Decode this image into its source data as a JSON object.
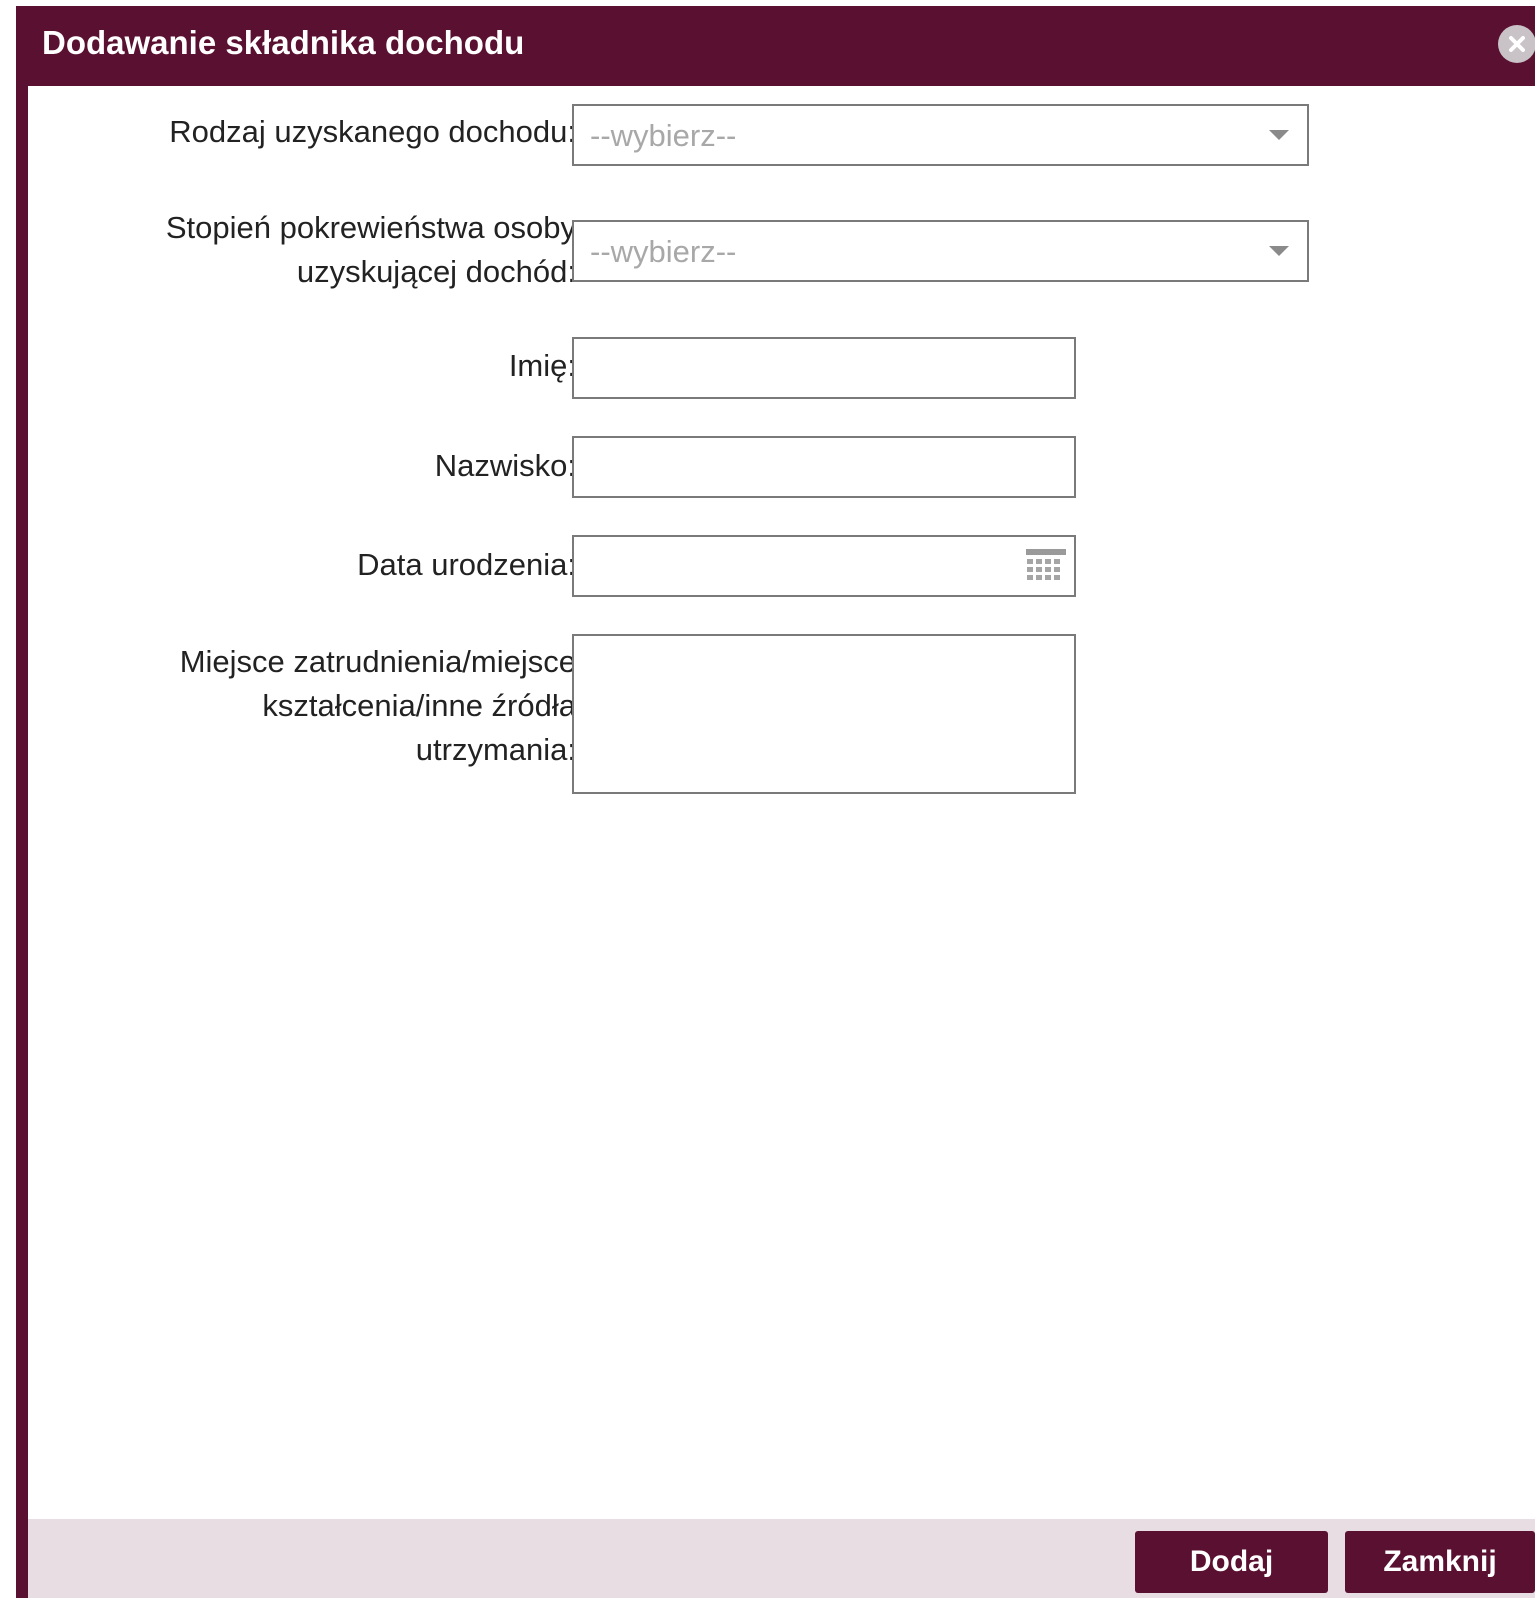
{
  "dialog": {
    "title": "Dodawanie składnika dochodu",
    "close_icon": "close-icon"
  },
  "form": {
    "income_type": {
      "label": "Rodzaj uzyskanego dochodu:",
      "placeholder": "--wybierz--"
    },
    "kinship": {
      "label_line1": "Stopień pokrewieństwa osoby",
      "label_line2": "uzyskującej dochód:",
      "placeholder": "--wybierz--"
    },
    "first_name": {
      "label": "Imię:",
      "value": ""
    },
    "last_name": {
      "label": "Nazwisko:",
      "value": ""
    },
    "birth_date": {
      "label": "Data urodzenia:",
      "value": "",
      "icon": "calendar-icon"
    },
    "workplace": {
      "label_line1": "Miejsce zatrudnienia/miejsce",
      "label_line2": "kształcenia/inne źródła",
      "label_line3": "utrzymania:",
      "value": ""
    }
  },
  "footer": {
    "add_label": "Dodaj",
    "close_label": "Zamknij"
  },
  "colors": {
    "header": "#5a1030",
    "footer": "#e7dde2",
    "button": "#5a1030"
  }
}
